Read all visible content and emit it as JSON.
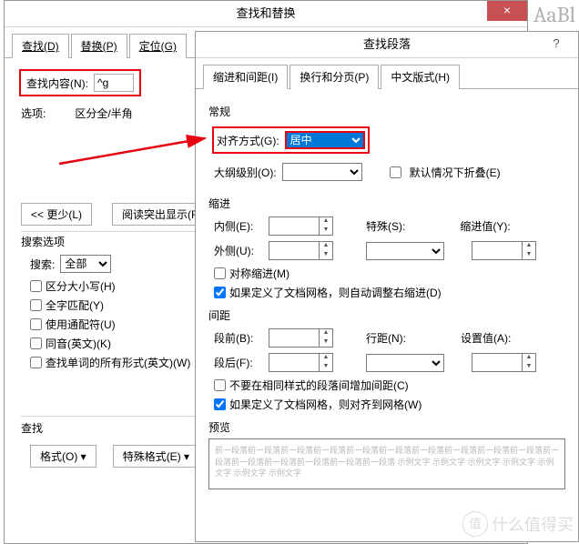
{
  "bg_text": "AaBl",
  "find_dialog": {
    "title": "查找和替换",
    "tabs": {
      "find": "查找(D)",
      "replace": "替换(P)",
      "goto": "定位(G)"
    },
    "find_label": "查找内容(N):",
    "find_value": "^g",
    "options_label": "选项:",
    "options_value": "区分全/半角",
    "less_btn": "<< 更少(L)",
    "highlight_btn": "阅读突出显示(R)",
    "search_options_title": "搜索选项",
    "search_label": "搜索:",
    "search_value": "全部",
    "checks": {
      "case": "区分大小写(H)",
      "whole": "全字匹配(Y)",
      "wildcard": "使用通配符(U)",
      "sounds": "同音(英文)(K)",
      "forms": "查找单词的所有形式(英文)(W)"
    },
    "find_section": "查找",
    "format_btn": "格式(O)",
    "special_btn": "特殊格式(E)"
  },
  "para_dialog": {
    "title": "查找段落",
    "tabs": {
      "indent": "缩进和间距(I)",
      "page": "换行和分页(P)",
      "chinese": "中文版式(H)"
    },
    "general_title": "常规",
    "align_label": "对齐方式(G):",
    "align_value": "居中",
    "outline_label": "大纲级别(O):",
    "outline_value": "",
    "collapse_check": "默认情况下折叠(E)",
    "indent_title": "缩进",
    "inside_label": "内侧(E):",
    "outside_label": "外侧(U):",
    "special_label": "特殊(S):",
    "indent_val_label": "缩进值(Y):",
    "sym_indent": "对称缩进(M)",
    "grid_indent": "如果定义了文档网格，则自动调整右缩进(D)",
    "spacing_title": "间距",
    "before_label": "段前(B):",
    "after_label": "段后(F):",
    "line_label": "行距(N):",
    "set_val_label": "设置值(A):",
    "no_space": "不要在相同样式的段落间增加间距(C)",
    "grid_align": "如果定义了文档网格，则对齐到网格(W)",
    "preview_title": "预览",
    "preview_text": "前一段落前一段落前一段落前一段落前一段落前一段落前一段落前一段落前一段落前一段落前一段落前一段落前一段落前一段落前一段落前一段落 示例文字 示例文字 示例文字 示例文字 示例文字 示例文字 示例文字"
  },
  "watermark": "什么值得买",
  "watermark_icon": "值"
}
